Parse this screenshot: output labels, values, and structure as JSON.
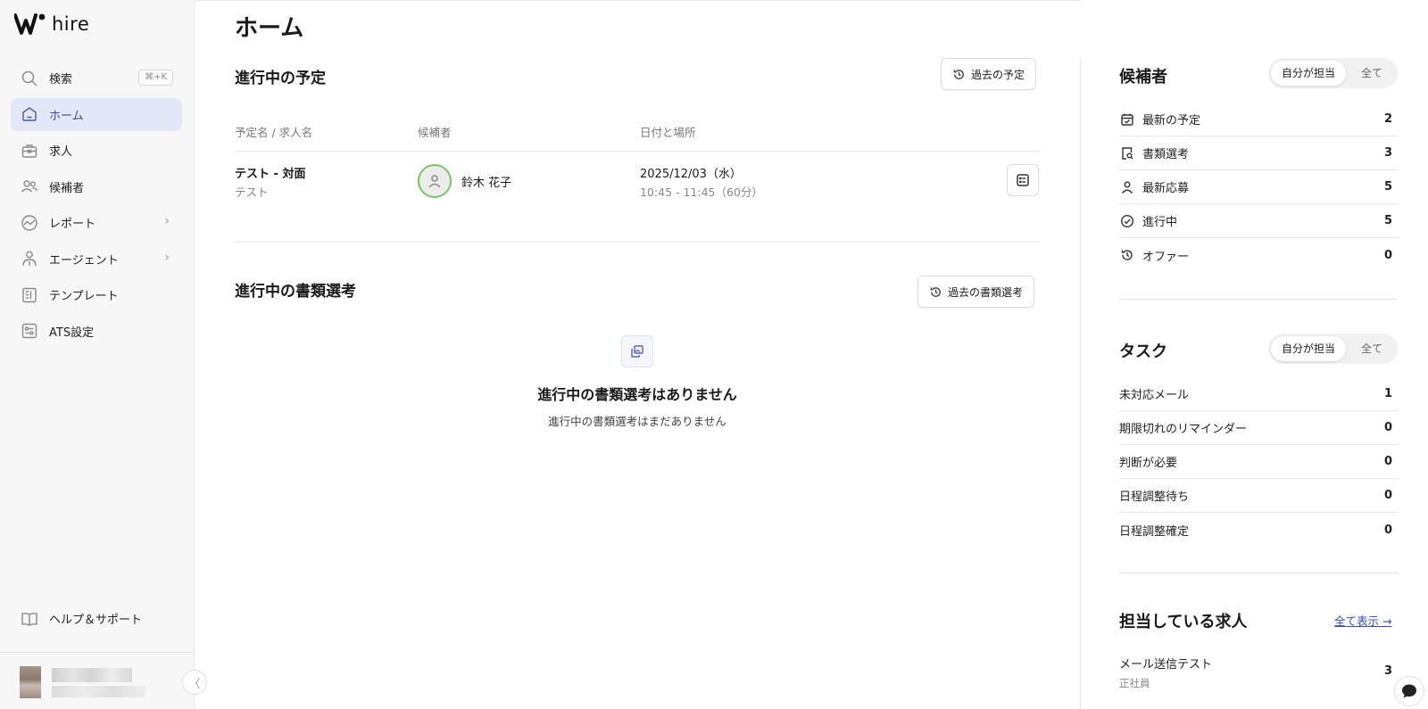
{
  "app": {
    "brand": "hire"
  },
  "sidebar": {
    "search_shortcut": "⌘+K",
    "items": [
      {
        "label": "検索",
        "icon": "search-icon"
      },
      {
        "label": "ホーム",
        "icon": "home-icon"
      },
      {
        "label": "求人",
        "icon": "briefcase-icon"
      },
      {
        "label": "候補者",
        "icon": "users-icon"
      },
      {
        "label": "レポート",
        "icon": "chart-icon"
      },
      {
        "label": "エージェント",
        "icon": "agent-icon"
      },
      {
        "label": "テンプレート",
        "icon": "template-icon"
      },
      {
        "label": "ATS設定",
        "icon": "settings-icon"
      }
    ],
    "help_label": "ヘルプ＆サポート",
    "collapse_glyph": "〈",
    "active_color": "#e3e8f8"
  },
  "main": {
    "page_title": "ホーム",
    "schedules": {
      "title": "進行中の予定",
      "past_button": "過去の予定",
      "columns": [
        "予定名 / 求人名",
        "候補者",
        "日付と場所"
      ],
      "rows": [
        {
          "event_name": "テスト - 対面",
          "job_name": "テスト",
          "candidate": "鈴木 花子",
          "date": "2025/12/03（水）",
          "time": "10:45 - 11:45（60分）"
        }
      ]
    },
    "screening": {
      "title": "進行中の書類選考",
      "past_button": "過去の書類選考",
      "empty_title": "進行中の書類選考はありません",
      "empty_sub": "進行中の書類選考はまだありません"
    }
  },
  "right": {
    "candidates": {
      "title": "候補者",
      "toggle_mine": "自分が担当",
      "toggle_all": "全て",
      "stats": [
        {
          "label": "最新の予定",
          "count": "2",
          "icon": "calendar-icon"
        },
        {
          "label": "書類選考",
          "count": "3",
          "icon": "document-search-icon"
        },
        {
          "label": "最新応募",
          "count": "5",
          "icon": "person-icon"
        },
        {
          "label": "進行中",
          "count": "5",
          "icon": "check-circle-icon"
        },
        {
          "label": "オファー",
          "count": "0",
          "icon": "history-icon"
        }
      ]
    },
    "tasks": {
      "title": "タスク",
      "toggle_mine": "自分が担当",
      "toggle_all": "全て",
      "stats": [
        {
          "label": "未対応メール",
          "count": "1"
        },
        {
          "label": "期限切れのリマインダー",
          "count": "0"
        },
        {
          "label": "判断が必要",
          "count": "0"
        },
        {
          "label": "日程調整待ち",
          "count": "0"
        },
        {
          "label": "日程調整確定",
          "count": "0"
        }
      ]
    },
    "jobs": {
      "title": "担当している求人",
      "view_all": "全て表示 →",
      "items": [
        {
          "title": "メール送信テスト",
          "type": "正社員",
          "count": "3"
        }
      ]
    }
  }
}
